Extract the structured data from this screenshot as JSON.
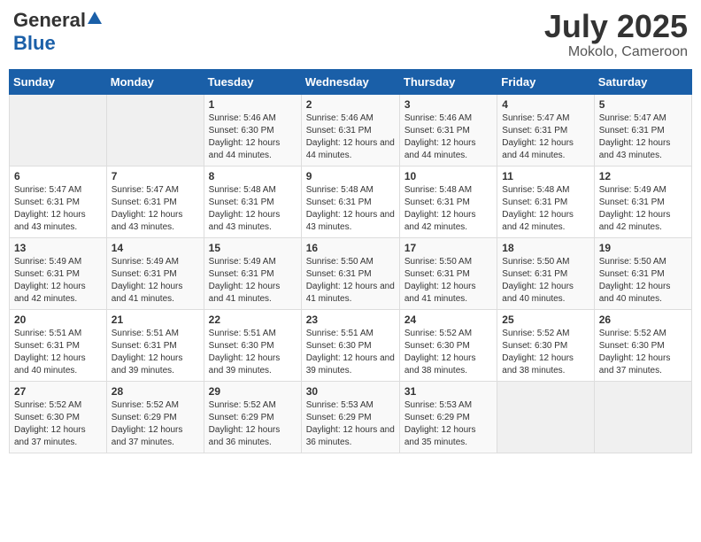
{
  "header": {
    "logo_general": "General",
    "logo_blue": "Blue",
    "title": "July 2025",
    "location": "Mokolo, Cameroon"
  },
  "weekdays": [
    "Sunday",
    "Monday",
    "Tuesday",
    "Wednesday",
    "Thursday",
    "Friday",
    "Saturday"
  ],
  "weeks": [
    [
      {
        "day": "",
        "sunrise": "",
        "sunset": "",
        "daylight": "",
        "empty": true
      },
      {
        "day": "",
        "sunrise": "",
        "sunset": "",
        "daylight": "",
        "empty": true
      },
      {
        "day": "1",
        "sunrise": "Sunrise: 5:46 AM",
        "sunset": "Sunset: 6:30 PM",
        "daylight": "Daylight: 12 hours and 44 minutes.",
        "empty": false
      },
      {
        "day": "2",
        "sunrise": "Sunrise: 5:46 AM",
        "sunset": "Sunset: 6:31 PM",
        "daylight": "Daylight: 12 hours and 44 minutes.",
        "empty": false
      },
      {
        "day": "3",
        "sunrise": "Sunrise: 5:46 AM",
        "sunset": "Sunset: 6:31 PM",
        "daylight": "Daylight: 12 hours and 44 minutes.",
        "empty": false
      },
      {
        "day": "4",
        "sunrise": "Sunrise: 5:47 AM",
        "sunset": "Sunset: 6:31 PM",
        "daylight": "Daylight: 12 hours and 44 minutes.",
        "empty": false
      },
      {
        "day": "5",
        "sunrise": "Sunrise: 5:47 AM",
        "sunset": "Sunset: 6:31 PM",
        "daylight": "Daylight: 12 hours and 43 minutes.",
        "empty": false
      }
    ],
    [
      {
        "day": "6",
        "sunrise": "Sunrise: 5:47 AM",
        "sunset": "Sunset: 6:31 PM",
        "daylight": "Daylight: 12 hours and 43 minutes.",
        "empty": false
      },
      {
        "day": "7",
        "sunrise": "Sunrise: 5:47 AM",
        "sunset": "Sunset: 6:31 PM",
        "daylight": "Daylight: 12 hours and 43 minutes.",
        "empty": false
      },
      {
        "day": "8",
        "sunrise": "Sunrise: 5:48 AM",
        "sunset": "Sunset: 6:31 PM",
        "daylight": "Daylight: 12 hours and 43 minutes.",
        "empty": false
      },
      {
        "day": "9",
        "sunrise": "Sunrise: 5:48 AM",
        "sunset": "Sunset: 6:31 PM",
        "daylight": "Daylight: 12 hours and 43 minutes.",
        "empty": false
      },
      {
        "day": "10",
        "sunrise": "Sunrise: 5:48 AM",
        "sunset": "Sunset: 6:31 PM",
        "daylight": "Daylight: 12 hours and 42 minutes.",
        "empty": false
      },
      {
        "day": "11",
        "sunrise": "Sunrise: 5:48 AM",
        "sunset": "Sunset: 6:31 PM",
        "daylight": "Daylight: 12 hours and 42 minutes.",
        "empty": false
      },
      {
        "day": "12",
        "sunrise": "Sunrise: 5:49 AM",
        "sunset": "Sunset: 6:31 PM",
        "daylight": "Daylight: 12 hours and 42 minutes.",
        "empty": false
      }
    ],
    [
      {
        "day": "13",
        "sunrise": "Sunrise: 5:49 AM",
        "sunset": "Sunset: 6:31 PM",
        "daylight": "Daylight: 12 hours and 42 minutes.",
        "empty": false
      },
      {
        "day": "14",
        "sunrise": "Sunrise: 5:49 AM",
        "sunset": "Sunset: 6:31 PM",
        "daylight": "Daylight: 12 hours and 41 minutes.",
        "empty": false
      },
      {
        "day": "15",
        "sunrise": "Sunrise: 5:49 AM",
        "sunset": "Sunset: 6:31 PM",
        "daylight": "Daylight: 12 hours and 41 minutes.",
        "empty": false
      },
      {
        "day": "16",
        "sunrise": "Sunrise: 5:50 AM",
        "sunset": "Sunset: 6:31 PM",
        "daylight": "Daylight: 12 hours and 41 minutes.",
        "empty": false
      },
      {
        "day": "17",
        "sunrise": "Sunrise: 5:50 AM",
        "sunset": "Sunset: 6:31 PM",
        "daylight": "Daylight: 12 hours and 41 minutes.",
        "empty": false
      },
      {
        "day": "18",
        "sunrise": "Sunrise: 5:50 AM",
        "sunset": "Sunset: 6:31 PM",
        "daylight": "Daylight: 12 hours and 40 minutes.",
        "empty": false
      },
      {
        "day": "19",
        "sunrise": "Sunrise: 5:50 AM",
        "sunset": "Sunset: 6:31 PM",
        "daylight": "Daylight: 12 hours and 40 minutes.",
        "empty": false
      }
    ],
    [
      {
        "day": "20",
        "sunrise": "Sunrise: 5:51 AM",
        "sunset": "Sunset: 6:31 PM",
        "daylight": "Daylight: 12 hours and 40 minutes.",
        "empty": false
      },
      {
        "day": "21",
        "sunrise": "Sunrise: 5:51 AM",
        "sunset": "Sunset: 6:31 PM",
        "daylight": "Daylight: 12 hours and 39 minutes.",
        "empty": false
      },
      {
        "day": "22",
        "sunrise": "Sunrise: 5:51 AM",
        "sunset": "Sunset: 6:30 PM",
        "daylight": "Daylight: 12 hours and 39 minutes.",
        "empty": false
      },
      {
        "day": "23",
        "sunrise": "Sunrise: 5:51 AM",
        "sunset": "Sunset: 6:30 PM",
        "daylight": "Daylight: 12 hours and 39 minutes.",
        "empty": false
      },
      {
        "day": "24",
        "sunrise": "Sunrise: 5:52 AM",
        "sunset": "Sunset: 6:30 PM",
        "daylight": "Daylight: 12 hours and 38 minutes.",
        "empty": false
      },
      {
        "day": "25",
        "sunrise": "Sunrise: 5:52 AM",
        "sunset": "Sunset: 6:30 PM",
        "daylight": "Daylight: 12 hours and 38 minutes.",
        "empty": false
      },
      {
        "day": "26",
        "sunrise": "Sunrise: 5:52 AM",
        "sunset": "Sunset: 6:30 PM",
        "daylight": "Daylight: 12 hours and 37 minutes.",
        "empty": false
      }
    ],
    [
      {
        "day": "27",
        "sunrise": "Sunrise: 5:52 AM",
        "sunset": "Sunset: 6:30 PM",
        "daylight": "Daylight: 12 hours and 37 minutes.",
        "empty": false
      },
      {
        "day": "28",
        "sunrise": "Sunrise: 5:52 AM",
        "sunset": "Sunset: 6:29 PM",
        "daylight": "Daylight: 12 hours and 37 minutes.",
        "empty": false
      },
      {
        "day": "29",
        "sunrise": "Sunrise: 5:52 AM",
        "sunset": "Sunset: 6:29 PM",
        "daylight": "Daylight: 12 hours and 36 minutes.",
        "empty": false
      },
      {
        "day": "30",
        "sunrise": "Sunrise: 5:53 AM",
        "sunset": "Sunset: 6:29 PM",
        "daylight": "Daylight: 12 hours and 36 minutes.",
        "empty": false
      },
      {
        "day": "31",
        "sunrise": "Sunrise: 5:53 AM",
        "sunset": "Sunset: 6:29 PM",
        "daylight": "Daylight: 12 hours and 35 minutes.",
        "empty": false
      },
      {
        "day": "",
        "sunrise": "",
        "sunset": "",
        "daylight": "",
        "empty": true
      },
      {
        "day": "",
        "sunrise": "",
        "sunset": "",
        "daylight": "",
        "empty": true
      }
    ]
  ]
}
